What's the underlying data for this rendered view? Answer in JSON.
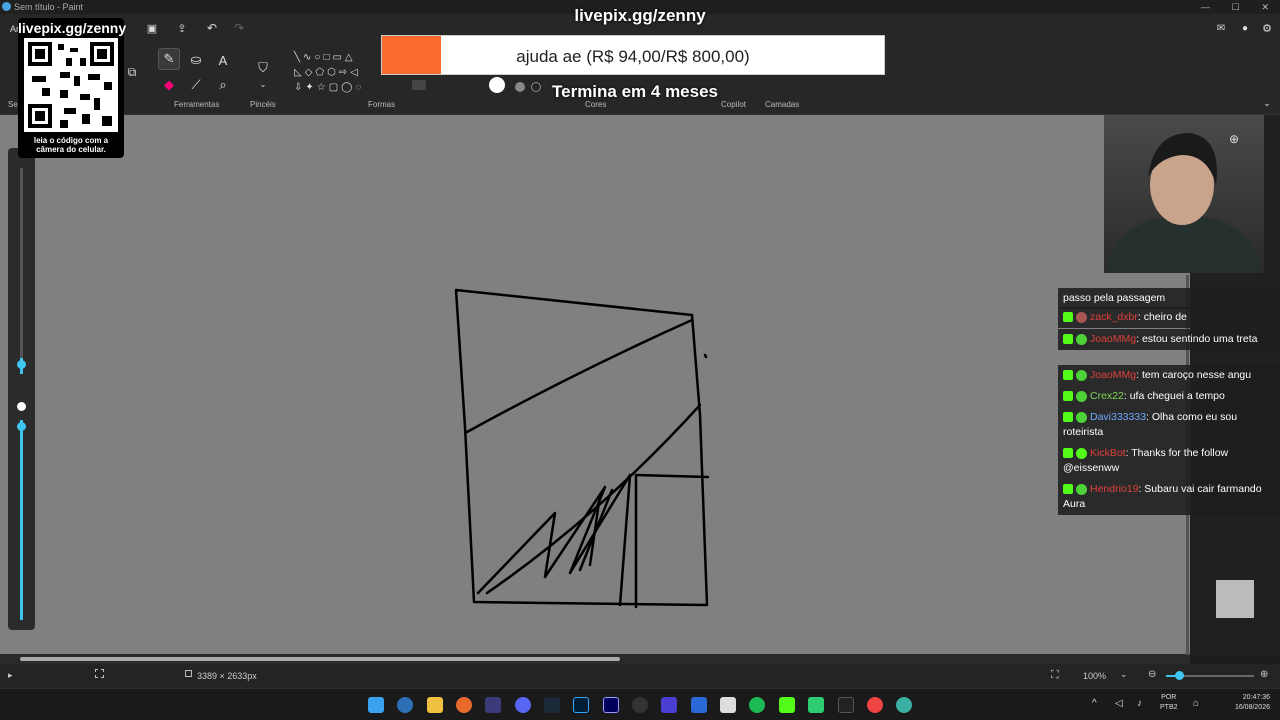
{
  "window": {
    "title": "Sem título - Paint"
  },
  "toolbar": {
    "groups": {
      "ferramentas": "Ferramentas",
      "pinceis": "Pincéis",
      "formas": "Formas",
      "cores": "Cores",
      "copilot": "Copilot",
      "camadas": "Camadas"
    },
    "menu_left": "Ar",
    "sel_label": "Sel"
  },
  "status": {
    "canvas_size": "3389 × 2633px",
    "zoom": "100%"
  },
  "overlay": {
    "qr_title": "livepix.gg/zenny",
    "qr_caption": "leia o código com a câmera do celular.",
    "goal_title": "livepix.gg/zenny",
    "goal_text": "ajuda ae (R$ 94,00/R$ 800,00)",
    "goal_progress": 0.1175,
    "goal_sub": "Termina em 4 meses"
  },
  "chat": {
    "messages": [
      {
        "user": "",
        "text": "passo pela passagem"
      },
      {
        "user": "zack_dxbr",
        "sep": ":",
        "text": "cheiro de"
      },
      {
        "user": "JoaoMMg",
        "sep": ":",
        "text": "estou sentindo uma treta"
      },
      {
        "user": "JoaoMMg",
        "sep": ":",
        "text": "tem caroço nesse angu"
      },
      {
        "user": "Crex22",
        "sep": ":",
        "text": "ufa cheguei a tempo"
      },
      {
        "user": "Davi333333",
        "sep": ":",
        "text": "Olha como eu sou roteirista"
      },
      {
        "user": "KickBot",
        "sep": ":",
        "text": "Thanks for the follow @eissenww"
      },
      {
        "user": "Hendrio19",
        "sep": ":",
        "text": "Subaru vai cair farmando Aura"
      }
    ]
  },
  "taskbar": {
    "lang1": "POR",
    "lang2": "PTB2",
    "time": "20:47:36",
    "date": "16/08/2026"
  },
  "colors": {
    "accent": "#f96b2c",
    "kick_green": "#53fc18",
    "canvas_bg": "#808080"
  }
}
